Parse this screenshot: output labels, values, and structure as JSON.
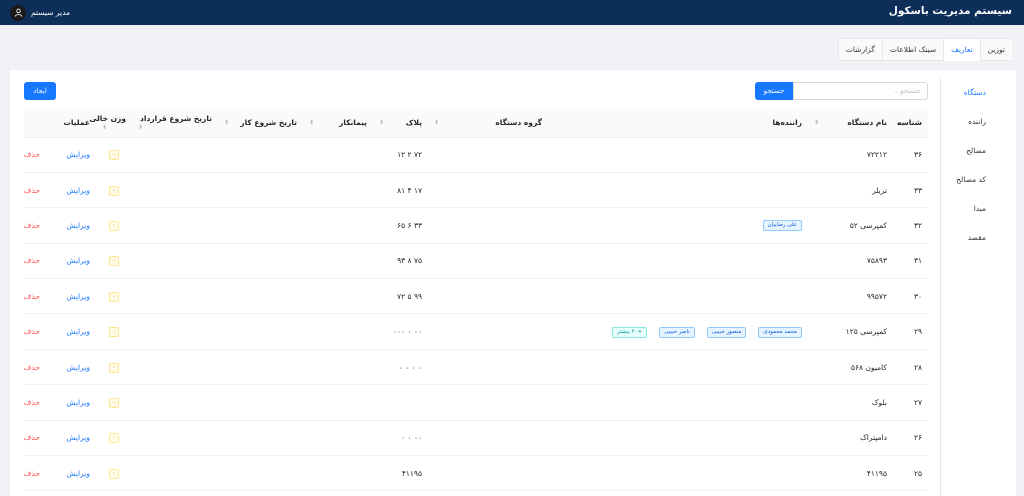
{
  "header": {
    "title": "سیستم مدیریت باسکول",
    "user_name": "مدیر سیستم"
  },
  "tabs": [
    {
      "label": "توزین",
      "active": false
    },
    {
      "label": "تعاریف",
      "active": true
    },
    {
      "label": "سینک اطلاعات",
      "active": false
    },
    {
      "label": "گزارشات",
      "active": false
    }
  ],
  "sidebar": {
    "items": [
      {
        "label": "دستگاه",
        "active": true
      },
      {
        "label": "راننده",
        "active": false
      },
      {
        "label": "مصالح",
        "active": false
      },
      {
        "label": "کد مصالح",
        "active": false
      },
      {
        "label": "مبدا",
        "active": false
      },
      {
        "label": "مقصد",
        "active": false
      }
    ]
  },
  "search": {
    "placeholder": "جستجو...",
    "button_label": "جستجو"
  },
  "create_label": "ایجاد",
  "columns": [
    "شناسه",
    "نام دستگاه",
    "راننده‌ها",
    "گروه دستگاه",
    "پلاک",
    "پیمانکار",
    "تاریخ شروع کار",
    "تاریخ شروع قرارداد",
    "وزن خالی",
    "عملیات"
  ],
  "actions": {
    "edit": "ویرایش",
    "delete": "حذف"
  },
  "rows": [
    {
      "id": "۳۶",
      "name": "۷۲۲۱۲",
      "drivers": [],
      "plate": "۷۲ ۲ ۱۲",
      "weight": "۰"
    },
    {
      "id": "۳۳",
      "name": "تریلر",
      "drivers": [],
      "plate": "۱۷ ۴ ۸۱",
      "weight": "۰"
    },
    {
      "id": "۳۲",
      "name": "کمپرسی ۵۲",
      "drivers": [
        "علی رضاییان"
      ],
      "plate": "۳۳ ۶ ۶۵",
      "weight": "۰"
    },
    {
      "id": "۳۱",
      "name": "۷۵۸۹۳",
      "drivers": [],
      "plate": "۷۵ ۸ ۹۳",
      "weight": "۰"
    },
    {
      "id": "۳۰",
      "name": "۹۹۵۷۲",
      "drivers": [],
      "plate": "۹۹ ۵ ۷۲",
      "weight": "۰"
    },
    {
      "id": "۲۹",
      "name": "کمپرسی ۱۲۵",
      "drivers": [
        "محمد محمودی",
        "منصور حبیبی",
        "ناصر حبیبی"
      ],
      "more": "+۲۰ بیشتر",
      "plate": "۰۰ ۰ ۰۰۰",
      "weight": "۰"
    },
    {
      "id": "۲۸",
      "name": "کامیون ۵۶۸",
      "drivers": [],
      "plate": "۰ ۰ ۰ ۰",
      "weight": "۰"
    },
    {
      "id": "۲۷",
      "name": "بلوک",
      "drivers": [],
      "plate": "",
      "weight": "۰"
    },
    {
      "id": "۲۶",
      "name": "دامپتراک",
      "drivers": [],
      "plate": "۰۰ ۰ ۰",
      "weight": "۰"
    },
    {
      "id": "۲۵",
      "name": "۴۱۱۹۵",
      "drivers": [],
      "plate": "۴۱۱۹۵",
      "weight": "۰"
    }
  ]
}
